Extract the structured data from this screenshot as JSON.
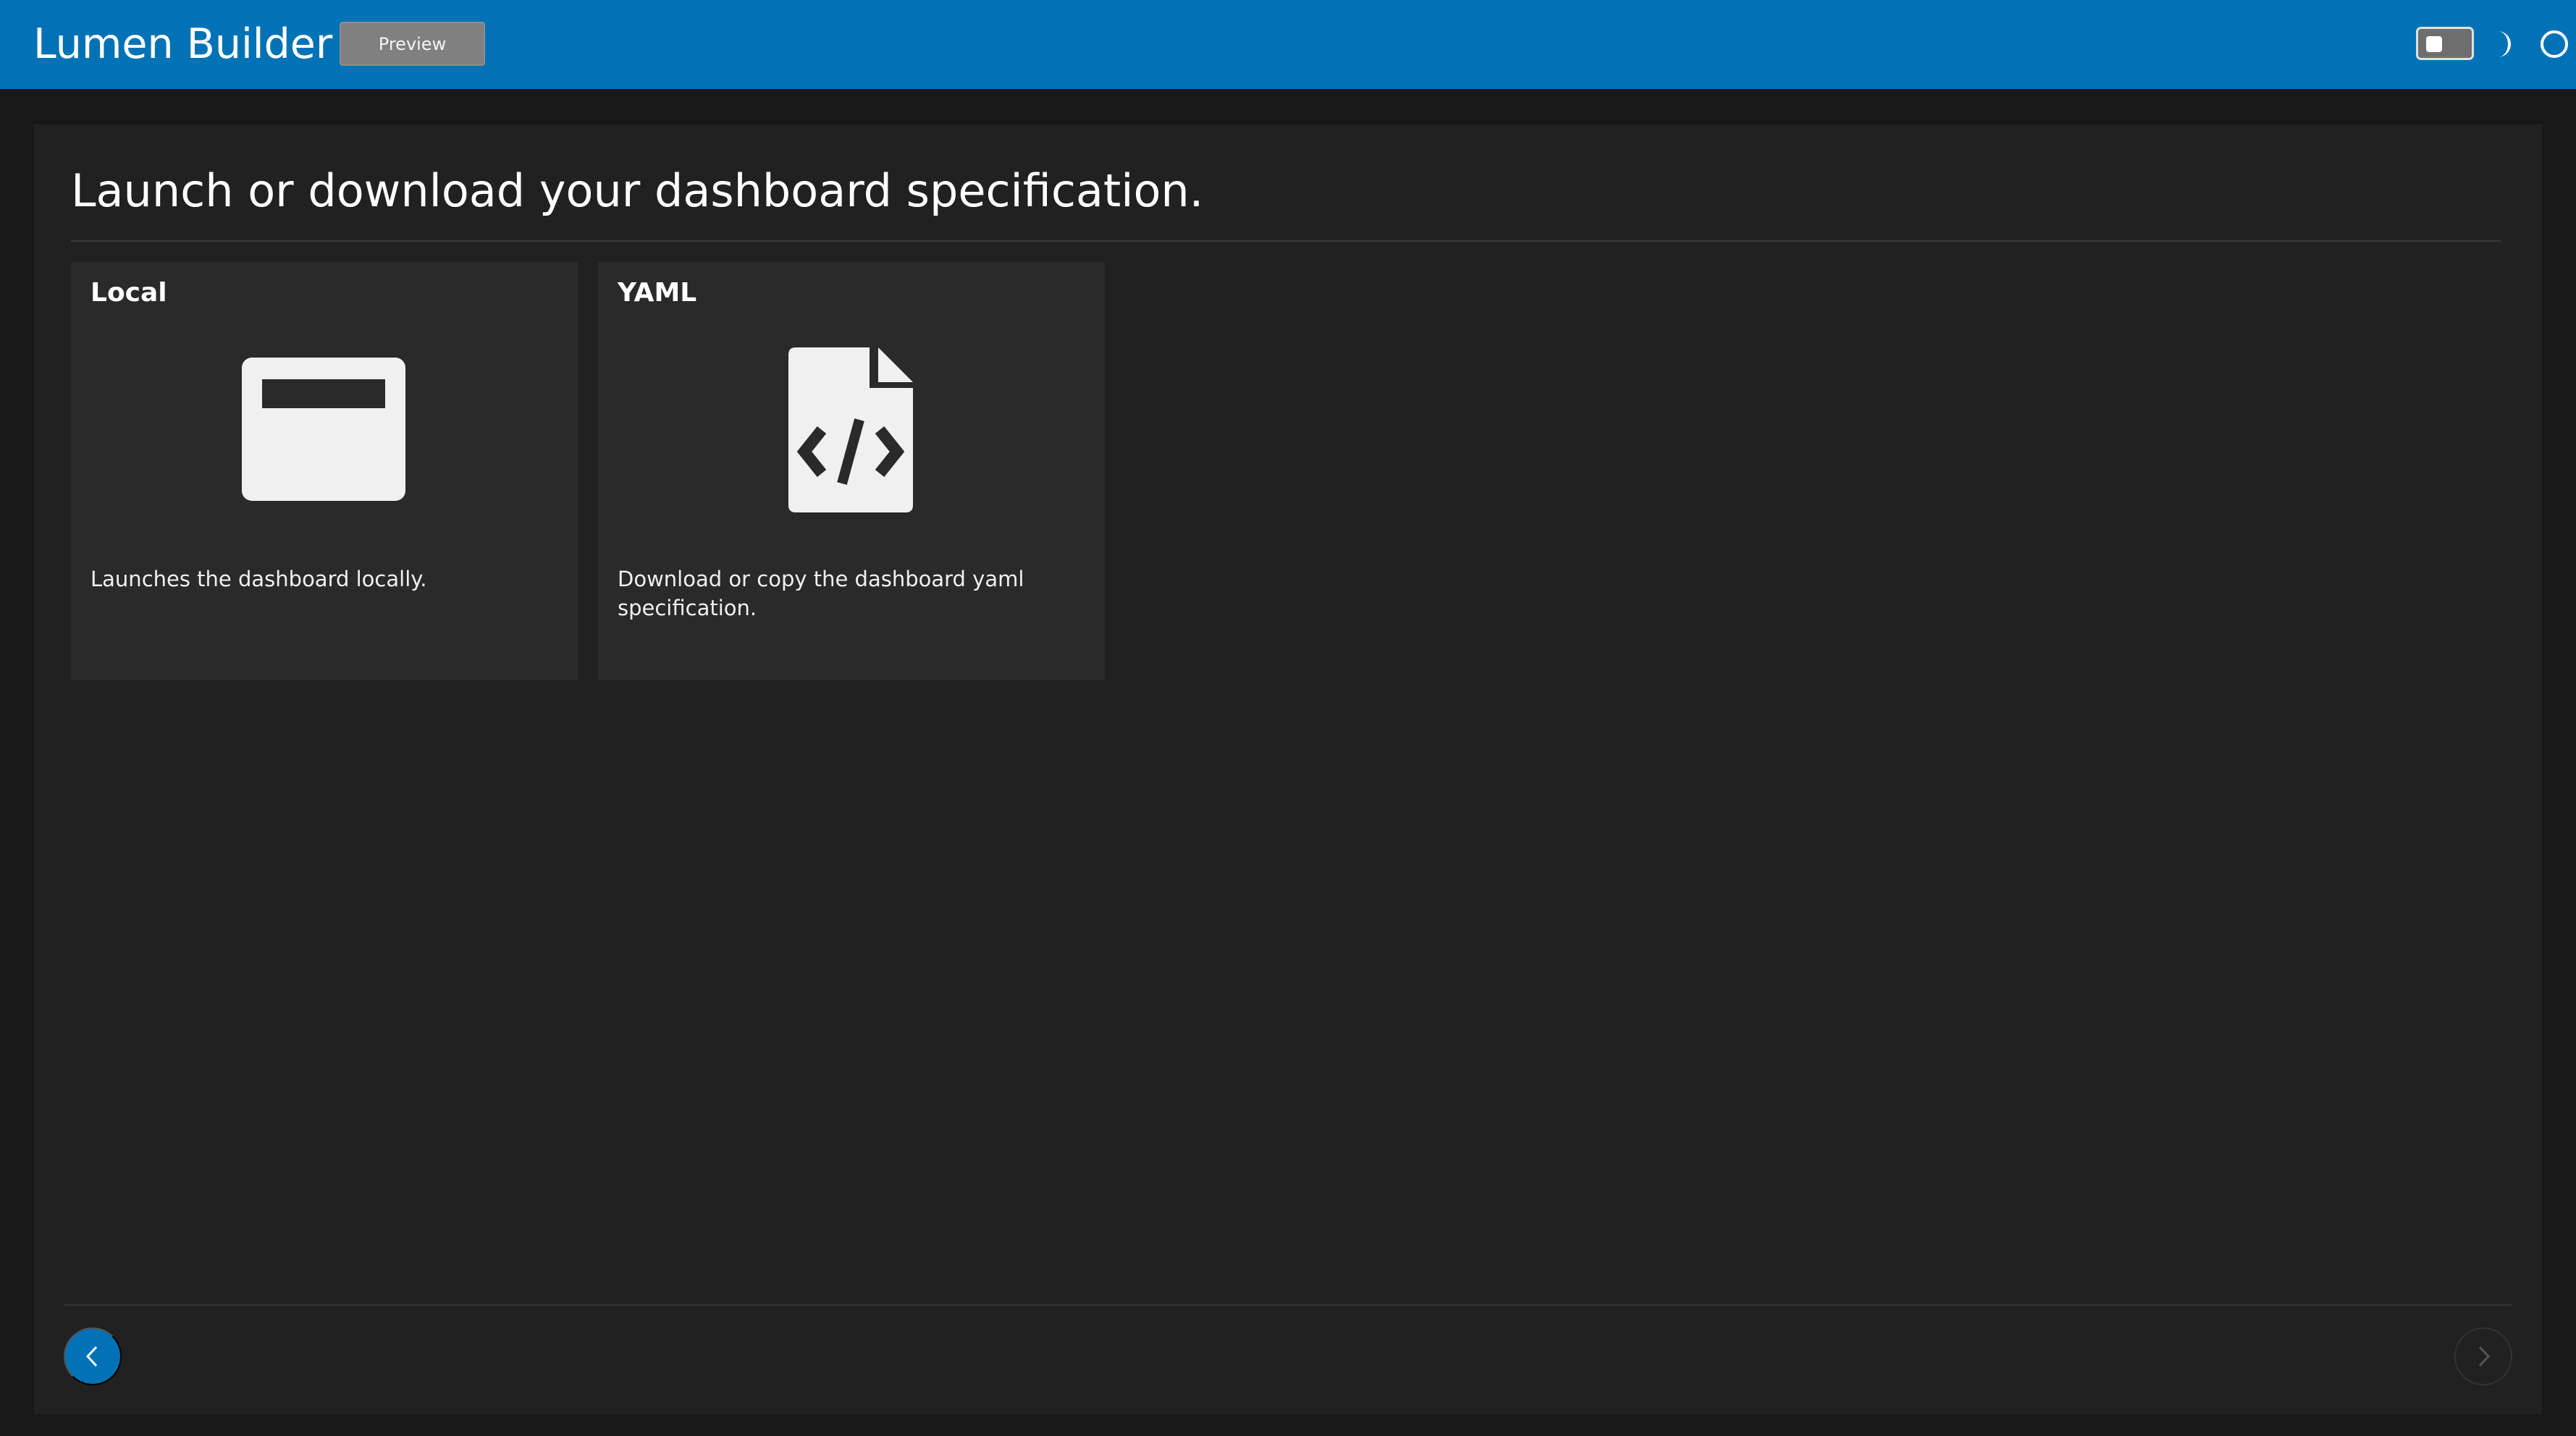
{
  "header": {
    "app_title": "Lumen Builder",
    "preview_label": "Preview",
    "theme_toggle_icon": "toggle-switch-icon",
    "dark_mode_icon": "moon-icon",
    "light_mode_icon": "circle-icon",
    "background_color": "#0072b5"
  },
  "main": {
    "title": "Launch or download your dashboard specification.",
    "cards": [
      {
        "title": "Local",
        "icon": "browser-window-icon",
        "description": "Launches the dashboard locally."
      },
      {
        "title": "YAML",
        "icon": "file-code-icon",
        "description": "Download or copy the dashboard yaml specification."
      }
    ]
  },
  "footer": {
    "prev_icon": "chevron-left-icon",
    "next_icon": "chevron-right-icon",
    "accent_color": "#0072b5"
  }
}
